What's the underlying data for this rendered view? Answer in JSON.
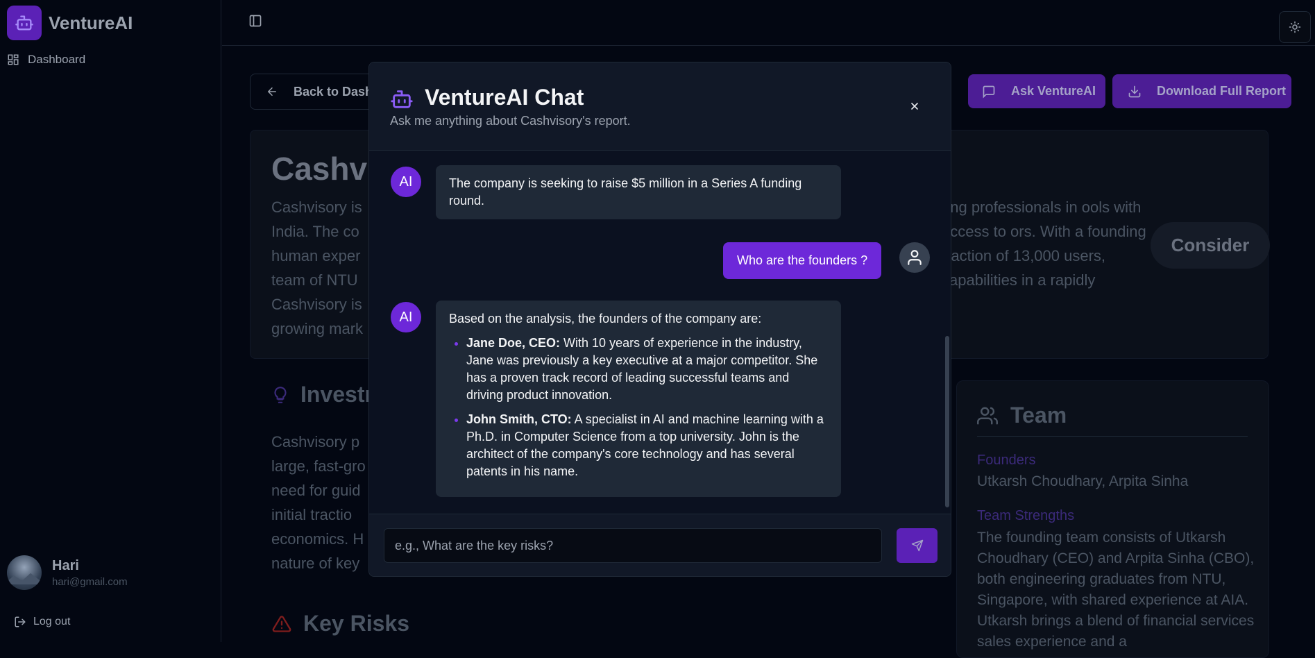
{
  "app": {
    "name": "VentureAI"
  },
  "sidebar": {
    "nav": [
      {
        "label": "Dashboard",
        "icon": "grid-icon"
      }
    ],
    "user": {
      "name": "Hari",
      "email": "hari@gmail.com"
    },
    "logout_label": "Log out"
  },
  "toolbar": {
    "back_label": "Back to Dash",
    "ask_label": "Ask VentureAI",
    "download_label": "Download Full Report"
  },
  "report": {
    "title": "Cashvi",
    "summary_left": "Cashvisory is India. The co human exper team of NTU Cashvisory is growing mark",
    "summary_right": "ung professionals in ools with access to ors. With a founding traction of 13,000 users, capabilities in a rapidly",
    "verdict": "Consider",
    "investment_heading": "Investr",
    "investment_text": "Cashvisory p large, fast-gro need for guid initial tractio economics. H nature of key",
    "risks_heading": "Key Risks",
    "team": {
      "heading": "Team",
      "founders_label": "Founders",
      "founders_value": "Utkarsh Choudhary, Arpita Sinha",
      "strengths_label": "Team Strengths",
      "strengths_value": "The founding team consists of Utkarsh Choudhary (CEO) and Arpita Sinha (CBO), both engineering graduates from NTU, Singapore, with shared experience at AIA. Utkarsh brings a blend of financial services sales experience and a"
    }
  },
  "chat": {
    "title": "VentureAI Chat",
    "subtitle": "Ask me anything about Cashvisory's report.",
    "ai_avatar_label": "AI",
    "messages": [
      {
        "role": "ai",
        "text": "The company is seeking to raise $5 million in a Series A funding round."
      },
      {
        "role": "user",
        "text": "Who are the founders ?"
      },
      {
        "role": "ai",
        "intro": "Based on the analysis, the founders of the company are:",
        "founders": [
          {
            "name": "Jane Doe, CEO:",
            "text": " With 10 years of experience in the industry, Jane was previously a key executive at a major competitor. She has a proven track record of leading successful teams and driving product innovation."
          },
          {
            "name": "John Smith, CTO:",
            "text": " A specialist in AI and machine learning with a Ph.D. in Computer Science from a top university. John is the architect of the company's core technology and has several patents in his name."
          }
        ]
      }
    ],
    "input_placeholder": "e.g., What are the key risks?"
  },
  "colors": {
    "accent": "#6d28d9",
    "background": "#030712",
    "panel": "#111827"
  }
}
